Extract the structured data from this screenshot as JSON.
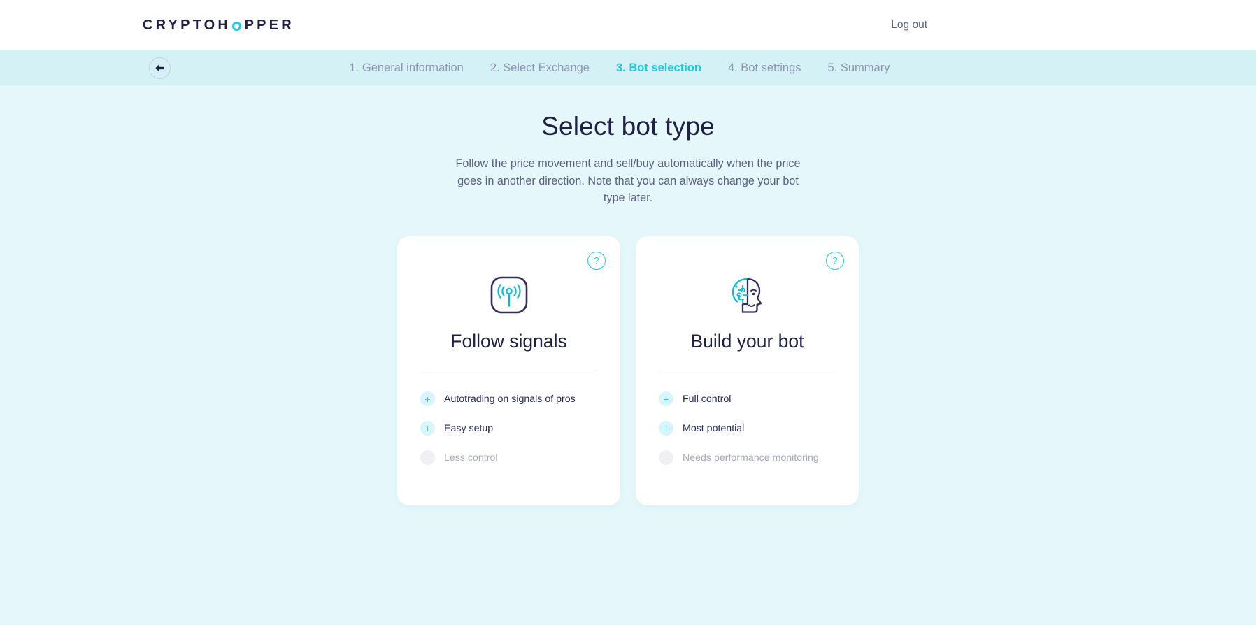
{
  "header": {
    "logo_text_1": "CRYPTOH",
    "logo_text_2": "PPER",
    "logo_ring_icon": "ring-o-icon",
    "logout_label": "Log out"
  },
  "stepnav": {
    "back_icon": "arrow-left-icon",
    "steps": [
      {
        "label": "1. General information",
        "active": false
      },
      {
        "label": "2. Select Exchange",
        "active": false
      },
      {
        "label": "3. Bot selection",
        "active": true
      },
      {
        "label": "4. Bot settings",
        "active": false
      },
      {
        "label": "5. Summary",
        "active": false
      }
    ]
  },
  "main": {
    "title": "Select bot type",
    "description": "Follow the price movement and sell/buy automatically when the price goes in another direction. Note that you can always change your bot type later.",
    "cards": [
      {
        "title": "Follow signals",
        "icon": "signal-broadcast-icon",
        "help_label": "?",
        "features": [
          {
            "sign": "+",
            "text": "Autotrading on signals of pros",
            "positive": true
          },
          {
            "sign": "+",
            "text": "Easy setup",
            "positive": true
          },
          {
            "sign": "–",
            "text": "Less control",
            "positive": false
          }
        ]
      },
      {
        "title": "Build your bot",
        "icon": "ai-head-circuit-icon",
        "help_label": "?",
        "features": [
          {
            "sign": "+",
            "text": "Full control",
            "positive": true
          },
          {
            "sign": "+",
            "text": "Most potential",
            "positive": true
          },
          {
            "sign": "–",
            "text": "Needs performance monitoring",
            "positive": false
          }
        ]
      }
    ]
  },
  "colors": {
    "accent_teal": "#1fc8de",
    "navy": "#201f45",
    "page_bg": "#e5f7fb",
    "nav_bg": "#d4f1f6",
    "muted": "#8e94b4"
  }
}
